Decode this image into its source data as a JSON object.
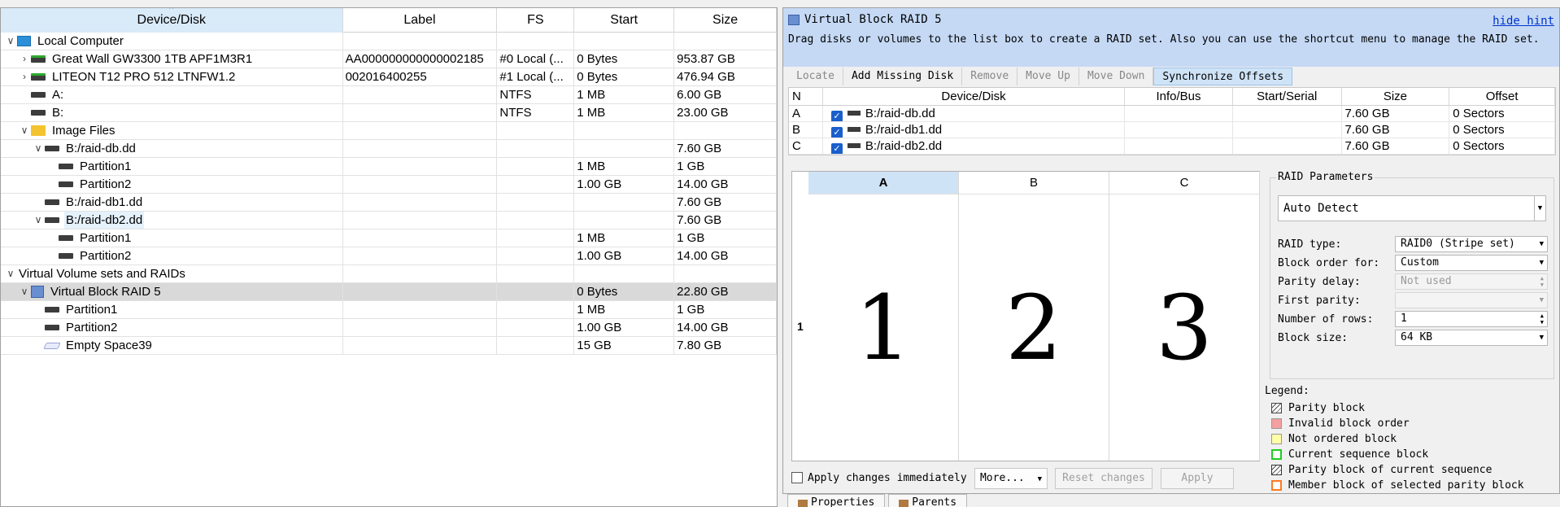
{
  "left": {
    "headers": [
      "Device/Disk",
      "Label",
      "FS",
      "Start",
      "Size"
    ],
    "rows": [
      {
        "level": 0,
        "chev": "v",
        "icon": "monitor-icon",
        "name": "Local Computer",
        "label": "",
        "fs": "",
        "start": "",
        "size": ""
      },
      {
        "level": 1,
        "chev": ">",
        "icon": "disk-icon-green",
        "name": "Great Wall GW3300 1TB APF1M3R1",
        "label": "AA000000000000002185",
        "fs": "#0 Local (...",
        "start": "0 Bytes",
        "size": "953.87 GB"
      },
      {
        "level": 1,
        "chev": ">",
        "icon": "disk-icon-green",
        "name": "LITEON T12 PRO 512 LTNFW1.2",
        "label": "002016400255",
        "fs": "#1 Local (...",
        "start": "0 Bytes",
        "size": "476.94 GB"
      },
      {
        "level": 1,
        "chev": "",
        "icon": "disk-icon",
        "name": "A:",
        "label": "",
        "fs": "NTFS",
        "start": "1 MB",
        "size": "6.00 GB"
      },
      {
        "level": 1,
        "chev": "",
        "icon": "disk-icon",
        "name": "B:",
        "label": "",
        "fs": "NTFS",
        "start": "1 MB",
        "size": "23.00 GB"
      },
      {
        "level": 1,
        "chev": "v",
        "icon": "folder-icon",
        "name": "Image Files",
        "label": "",
        "fs": "",
        "start": "",
        "size": ""
      },
      {
        "level": 2,
        "chev": "v",
        "icon": "disk-icon",
        "name": "B:/raid-db.dd",
        "label": "",
        "fs": "",
        "start": "",
        "size": "7.60 GB"
      },
      {
        "level": 3,
        "chev": "",
        "icon": "disk-icon",
        "name": "Partition1",
        "label": "",
        "fs": "",
        "start": "1 MB",
        "size": "1 GB"
      },
      {
        "level": 3,
        "chev": "",
        "icon": "disk-icon",
        "name": "Partition2",
        "label": "",
        "fs": "",
        "start": "1.00 GB",
        "size": "14.00 GB"
      },
      {
        "level": 2,
        "chev": "",
        "icon": "disk-icon",
        "name": "B:/raid-db1.dd",
        "label": "",
        "fs": "",
        "start": "",
        "size": "7.60 GB"
      },
      {
        "level": 2,
        "chev": "v",
        "icon": "disk-icon",
        "name": "B:/raid-db2.dd",
        "label": "",
        "fs": "",
        "start": "",
        "size": "7.60 GB",
        "hl": true
      },
      {
        "level": 3,
        "chev": "",
        "icon": "disk-icon",
        "name": "Partition1",
        "label": "",
        "fs": "",
        "start": "1 MB",
        "size": "1 GB"
      },
      {
        "level": 3,
        "chev": "",
        "icon": "disk-icon",
        "name": "Partition2",
        "label": "",
        "fs": "",
        "start": "1.00 GB",
        "size": "14.00 GB"
      },
      {
        "level": 0,
        "chev": "v",
        "icon": "",
        "name": "Virtual Volume sets and RAIDs",
        "label": "",
        "fs": "",
        "start": "",
        "size": ""
      },
      {
        "level": 1,
        "chev": "v",
        "icon": "raid-icon",
        "name": "Virtual Block RAID 5",
        "label": "",
        "fs": "",
        "start": "0 Bytes",
        "size": "22.80 GB",
        "sel": true
      },
      {
        "level": 2,
        "chev": "",
        "icon": "disk-icon",
        "name": "Partition1",
        "label": "",
        "fs": "",
        "start": "1 MB",
        "size": "1 GB"
      },
      {
        "level": 2,
        "chev": "",
        "icon": "disk-icon",
        "name": "Partition2",
        "label": "",
        "fs": "",
        "start": "1.00 GB",
        "size": "14.00 GB"
      },
      {
        "level": 2,
        "chev": "",
        "icon": "empty-space-icon",
        "name": "Empty Space39",
        "label": "",
        "fs": "",
        "start": "15 GB",
        "size": "7.80 GB"
      }
    ]
  },
  "hint": {
    "title": "Virtual Block RAID 5",
    "hide": "hide hint",
    "message": "Drag disks or volumes to the list box to create a RAID set. Also you can use the shortcut menu to manage the RAID set."
  },
  "toolbar": [
    {
      "label": "Locate",
      "state": "disabled"
    },
    {
      "label": "Add Missing Disk",
      "state": "enabled"
    },
    {
      "label": "Remove",
      "state": "disabled"
    },
    {
      "label": "Move Up",
      "state": "disabled"
    },
    {
      "label": "Move Down",
      "state": "disabled"
    },
    {
      "label": "Synchronize Offsets",
      "state": "active"
    }
  ],
  "disks": {
    "headers": [
      "N",
      "Device/Disk",
      "Info/Bus",
      "Start/Serial",
      "Size",
      "Offset"
    ],
    "rows": [
      {
        "n": "A",
        "device": "B:/raid-db.dd",
        "info": "",
        "serial": "",
        "size": "7.60 GB",
        "offset": "0 Sectors"
      },
      {
        "n": "B",
        "device": "B:/raid-db1.dd",
        "info": "",
        "serial": "",
        "size": "7.60 GB",
        "offset": "0 Sectors"
      },
      {
        "n": "C",
        "device": "B:/raid-db2.dd",
        "info": "",
        "serial": "",
        "size": "7.60 GB",
        "offset": "0 Sectors"
      }
    ]
  },
  "grid": {
    "columns": [
      "A",
      "B",
      "C"
    ],
    "row_label": "1",
    "cells": [
      "1",
      "2",
      "3"
    ]
  },
  "params": {
    "group_title": "RAID Parameters",
    "preset": "Auto Detect",
    "fields": [
      {
        "label": "RAID type:",
        "value": "RAID0 (Stripe set)",
        "disabled": false,
        "kind": "combo"
      },
      {
        "label": "Block order for:",
        "value": "Custom",
        "disabled": false,
        "kind": "combo"
      },
      {
        "label": "Parity delay:",
        "value": "Not used",
        "disabled": true,
        "kind": "spin"
      },
      {
        "label": "First parity:",
        "value": "",
        "disabled": true,
        "kind": "combo"
      },
      {
        "label": "Number of rows:",
        "value": "1",
        "disabled": false,
        "kind": "spin"
      },
      {
        "label": "Block size:",
        "value": "64 KB",
        "disabled": false,
        "kind": "combo"
      }
    ]
  },
  "legend": {
    "title": "Legend:",
    "items": [
      {
        "label": "Parity block",
        "fill": "#ffffff",
        "border": "#444444",
        "hatch": true
      },
      {
        "label": "Invalid block order",
        "fill": "#f4a0a0",
        "border": "#999999",
        "hatch": false
      },
      {
        "label": "Not ordered block",
        "fill": "#ffffa8",
        "border": "#999999",
        "hatch": false
      },
      {
        "label": "Current sequence block",
        "fill": "#ffffff",
        "border": "#22cc22",
        "hatch": false
      },
      {
        "label": "Parity block of current sequence",
        "fill": "#ffffff",
        "border": "#333333",
        "hatch": true
      },
      {
        "label": "Member block of selected parity block",
        "fill": "#ffffff",
        "border": "#ff7a20",
        "hatch": false
      }
    ]
  },
  "bottom": {
    "apply_immediately": "Apply changes immediately",
    "more": "More...",
    "reset": "Reset changes",
    "apply": "Apply"
  },
  "tabs": [
    "Properties",
    "Parents"
  ]
}
